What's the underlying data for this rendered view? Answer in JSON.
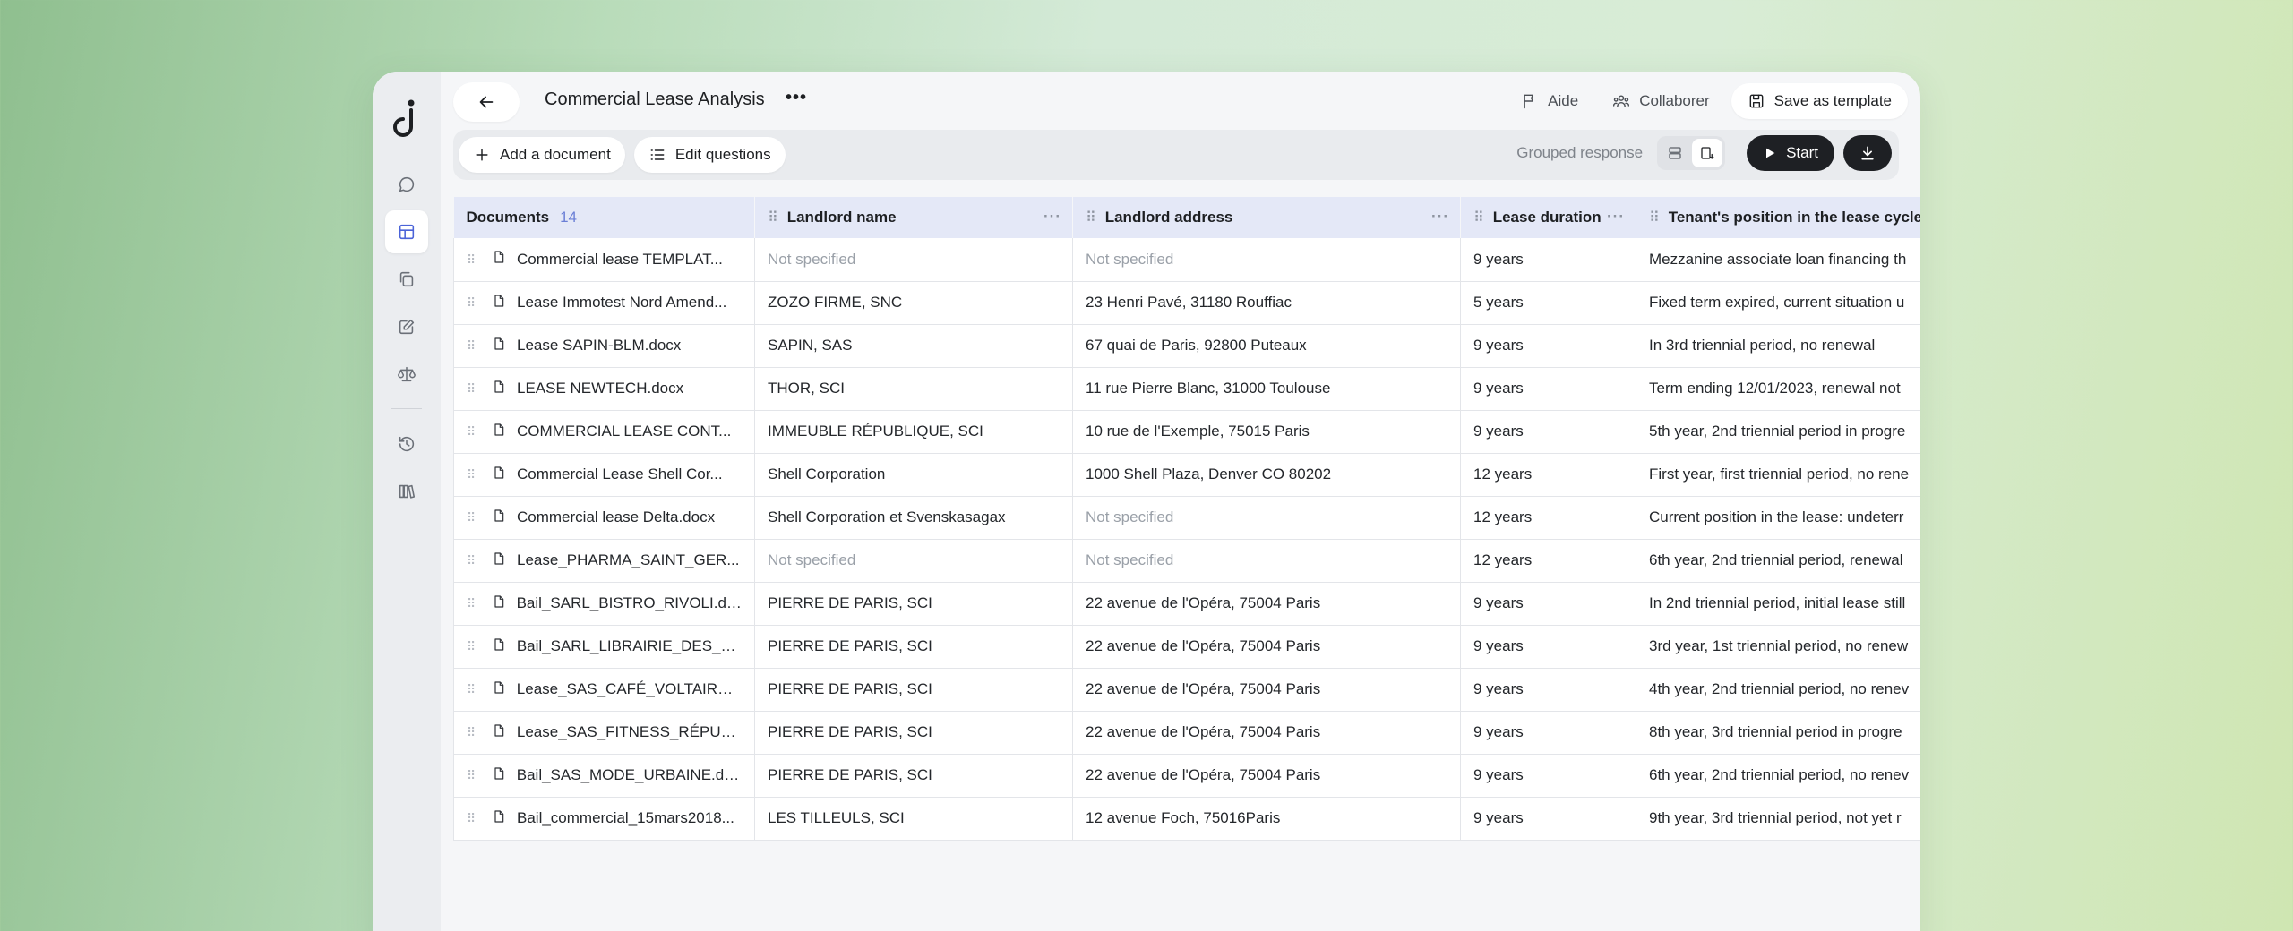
{
  "app": {
    "title": "Commercial Lease Analysis",
    "logo": "d"
  },
  "rail": {
    "items": [
      {
        "icon": "chat-icon"
      },
      {
        "icon": "table-icon",
        "active": true
      },
      {
        "icon": "copy-icon"
      },
      {
        "icon": "edit-icon"
      },
      {
        "icon": "scale-icon"
      },
      {
        "icon": "history-icon"
      },
      {
        "icon": "library-icon"
      }
    ]
  },
  "header": {
    "help_label": "Aide",
    "collab_label": "Collaborer",
    "save_template_label": "Save as template"
  },
  "toolbar": {
    "add_document_label": "Add a document",
    "edit_questions_label": "Edit questions",
    "grouped_response_label": "Grouped response",
    "start_label": "Start"
  },
  "table": {
    "documents_header": "Documents",
    "documents_count": "14",
    "columns": [
      "Landlord name",
      "Landlord address",
      "Lease duration",
      "Tenant's position in the lease cycle"
    ],
    "rows": [
      {
        "doc": "Commercial lease TEMPLAT...",
        "landlord": "Not specified",
        "address": "Not specified",
        "duration": "9 years",
        "position": "Mezzanine associate loan financing th"
      },
      {
        "doc": "Lease Immotest Nord Amend...",
        "landlord": "ZOZO FIRME, SNC",
        "address": "23 Henri Pavé, 31180 Rouffiac",
        "duration": "5 years",
        "position": "Fixed term expired, current situation u"
      },
      {
        "doc": "Lease SAPIN-BLM.docx",
        "landlord": "SAPIN, SAS",
        "address": "67 quai de Paris, 92800 Puteaux",
        "duration": "9 years",
        "position": "In 3rd triennial period, no renewal"
      },
      {
        "doc": "LEASE NEWTECH.docx",
        "landlord": "THOR, SCI",
        "address": "11 rue Pierre Blanc, 31000 Toulouse",
        "duration": "9 years",
        "position": "Term ending 12/01/2023, renewal not"
      },
      {
        "doc": "COMMERCIAL LEASE CONT...",
        "landlord": "IMMEUBLE RÉPUBLIQUE, SCI",
        "address": "10 rue de l'Exemple, 75015 Paris",
        "duration": "9 years",
        "position": "5th year, 2nd triennial period in progre"
      },
      {
        "doc": "Commercial Lease Shell Cor...",
        "landlord": "Shell Corporation",
        "address": "1000 Shell Plaza, Denver CO 80202",
        "duration": "12 years",
        "position": "First year, first triennial period, no rene"
      },
      {
        "doc": "Commercial lease Delta.docx",
        "landlord": "Shell Corporation et Svenskasagax",
        "address": "Not specified",
        "duration": "12 years",
        "position": "Current position in the lease: undeterr"
      },
      {
        "doc": "Lease_PHARMA_SAINT_GER...",
        "landlord": "Not specified",
        "address": "Not specified",
        "duration": "12 years",
        "position": "6th year, 2nd triennial period, renewal"
      },
      {
        "doc": "Bail_SARL_BISTRO_RIVOLI.do...",
        "landlord": "PIERRE DE PARIS, SCI",
        "address": "22 avenue de l'Opéra, 75004 Paris",
        "duration": "9 years",
        "position": "In 2nd triennial period, initial lease still"
      },
      {
        "doc": "Bail_SARL_LIBRAIRIE_DES_H...",
        "landlord": "PIERRE DE PARIS, SCI",
        "address": "22 avenue de l'Opéra, 75004 Paris",
        "duration": "9 years",
        "position": "3rd year, 1st triennial period, no renew"
      },
      {
        "doc": "Lease_SAS_CAFÉ_VOLTAIRE....",
        "landlord": "PIERRE DE PARIS, SCI",
        "address": "22 avenue de l'Opéra, 75004 Paris",
        "duration": "9 years",
        "position": "4th year, 2nd triennial period, no renev"
      },
      {
        "doc": "Lease_SAS_FITNESS_RÉPUB...",
        "landlord": "PIERRE DE PARIS, SCI",
        "address": "22 avenue de l'Opéra, 75004 Paris",
        "duration": "9 years",
        "position": "8th year, 3rd triennial period in progre"
      },
      {
        "doc": "Bail_SAS_MODE_URBAINE.do...",
        "landlord": "PIERRE DE PARIS, SCI",
        "address": "22 avenue de l'Opéra, 75004 Paris",
        "duration": "9 years",
        "position": "6th year, 2nd triennial period, no renev"
      },
      {
        "doc": "Bail_commercial_15mars2018...",
        "landlord": "LES TILLEULS, SCI",
        "address": "12 avenue Foch, 75016Paris",
        "duration": "9 years",
        "position": "9th year, 3rd triennial period, not yet r"
      }
    ]
  }
}
